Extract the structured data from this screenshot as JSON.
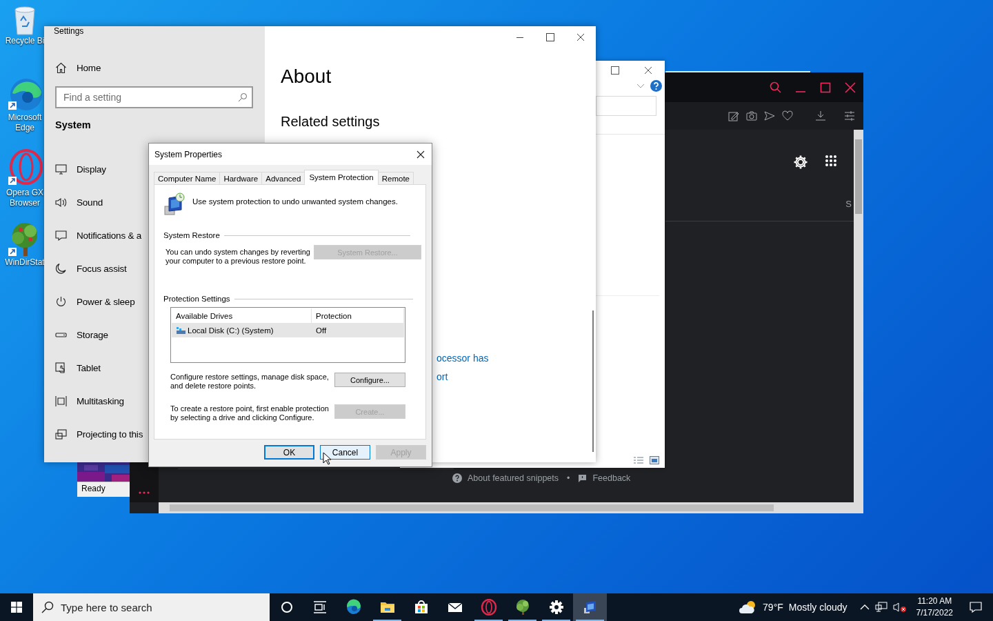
{
  "desktop": {
    "icons": [
      {
        "label": "Recycle Bi"
      },
      {
        "label": "Microsoft Edge"
      },
      {
        "label": "Opera GX Browser"
      },
      {
        "label": "WinDirStat"
      }
    ]
  },
  "windirstat_window": {
    "status": "Ready"
  },
  "browser_window": {
    "side_text": "S",
    "footer": {
      "snippets_link": "About featured snippets",
      "separator": "•",
      "feedback_link": "Feedback"
    }
  },
  "settings_window": {
    "title": "Settings",
    "home": "Home",
    "search": {
      "placeholder": "Find a setting"
    },
    "section": "System",
    "nav": [
      {
        "label": "Display"
      },
      {
        "label": "Sound"
      },
      {
        "label": "Notifications & a"
      },
      {
        "label": "Focus assist"
      },
      {
        "label": "Power & sleep"
      },
      {
        "label": "Storage"
      },
      {
        "label": "Tablet"
      },
      {
        "label": "Multitasking"
      },
      {
        "label": "Projecting to this"
      }
    ],
    "page_title": "About",
    "related_heading": "Related settings",
    "link_fragments": [
      "ocessor has",
      "ort"
    ]
  },
  "system_properties": {
    "title": "System Properties",
    "tabs": [
      {
        "label": "Computer Name",
        "selected": false
      },
      {
        "label": "Hardware",
        "selected": false
      },
      {
        "label": "Advanced",
        "selected": false
      },
      {
        "label": "System Protection",
        "selected": true
      },
      {
        "label": "Remote",
        "selected": false
      }
    ],
    "intro": "Use system protection to undo unwanted system changes.",
    "system_restore": {
      "heading": "System Restore",
      "text": "You can undo system changes by reverting your computer to a previous restore point.",
      "button": {
        "label": "System Restore...",
        "disabled": true
      }
    },
    "protection_settings": {
      "heading": "Protection Settings",
      "columns": [
        "Available Drives",
        "Protection"
      ],
      "rows": [
        {
          "drive": "Local Disk (C:) (System)",
          "protection": "Off",
          "selected": true
        }
      ],
      "configure": {
        "text": "Configure restore settings, manage disk space, and delete restore points.",
        "button": {
          "label": "Configure...",
          "disabled": false
        }
      },
      "create": {
        "text": "To create a restore point, first enable protection by selecting a drive and clicking Configure.",
        "button": {
          "label": "Create...",
          "disabled": true
        }
      }
    },
    "buttons": [
      {
        "label": "OK",
        "default": true,
        "hovered": false,
        "disabled": false
      },
      {
        "label": "Cancel",
        "default": false,
        "hovered": true,
        "disabled": false
      },
      {
        "label": "Apply",
        "default": false,
        "hovered": false,
        "disabled": true
      }
    ]
  },
  "taskbar": {
    "search": {
      "placeholder": "Type here to search"
    },
    "apps": [
      {
        "running": false,
        "active": false
      },
      {
        "running": true,
        "active": false
      },
      {
        "running": false,
        "active": false
      },
      {
        "running": false,
        "active": false
      },
      {
        "running": true,
        "active": false
      },
      {
        "running": true,
        "active": false
      },
      {
        "running": true,
        "active": false
      },
      {
        "running": true,
        "active": true
      }
    ],
    "weather": {
      "temperature": "79°F",
      "condition": "Mostly cloudy"
    },
    "clock": {
      "time": "11:20 AM",
      "date": "7/17/2022"
    }
  }
}
